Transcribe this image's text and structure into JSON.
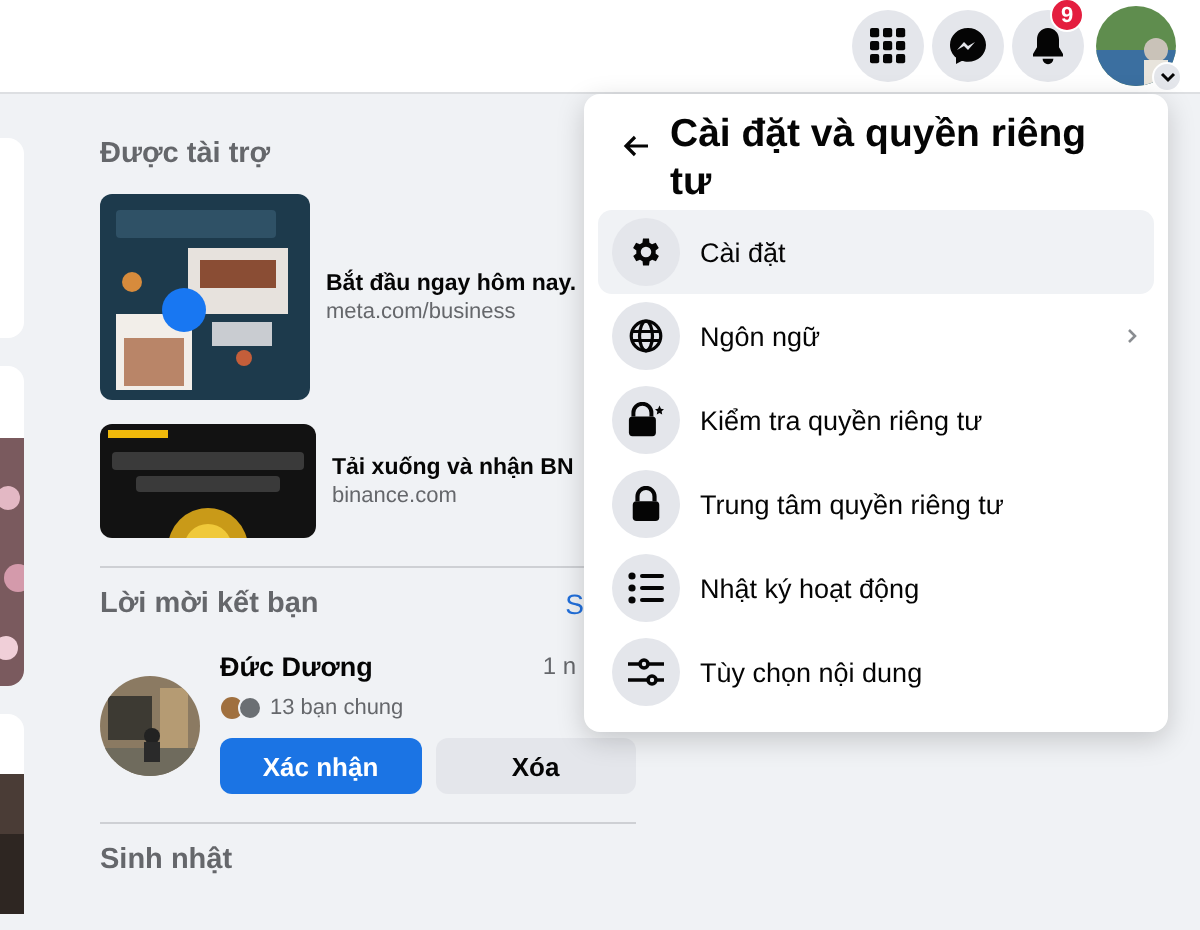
{
  "topbar": {
    "icons": [
      {
        "kind": "apps"
      },
      {
        "kind": "messenger"
      },
      {
        "kind": "bell",
        "badge": "9"
      },
      {
        "kind": "avatar"
      }
    ]
  },
  "sponsored": {
    "heading": "Được tài trợ",
    "ads": [
      {
        "title": "Bắt đầu ngay hôm nay.",
        "domain": "meta.com/business"
      },
      {
        "title": "Tải xuống và nhận BN",
        "domain": "binance.com"
      }
    ]
  },
  "friend_requests": {
    "heading": "Lời mời kết bạn",
    "see_all": "S",
    "requests": [
      {
        "name": "Đức Dương",
        "time": "1 n",
        "mutual": "13 bạn chung",
        "confirm": "Xác nhận",
        "delete": "Xóa"
      }
    ]
  },
  "birthdays": {
    "heading": "Sinh nhật"
  },
  "menu": {
    "title": "Cài đặt và quyền riêng tư",
    "items": [
      {
        "label": "Cài đặt",
        "kind": "gear",
        "selected": true,
        "has_submenu": false
      },
      {
        "label": "Ngôn ngữ",
        "kind": "globe",
        "selected": false,
        "has_submenu": true
      },
      {
        "label": "Kiểm tra quyền riêng tư",
        "kind": "lock-check",
        "selected": false,
        "has_submenu": false
      },
      {
        "label": "Trung tâm quyền riêng tư",
        "kind": "lock",
        "selected": false,
        "has_submenu": false
      },
      {
        "label": "Nhật ký hoạt động",
        "kind": "list",
        "selected": false,
        "has_submenu": false
      },
      {
        "label": "Tùy chọn nội dung",
        "kind": "sliders",
        "selected": false,
        "has_submenu": false
      }
    ]
  }
}
